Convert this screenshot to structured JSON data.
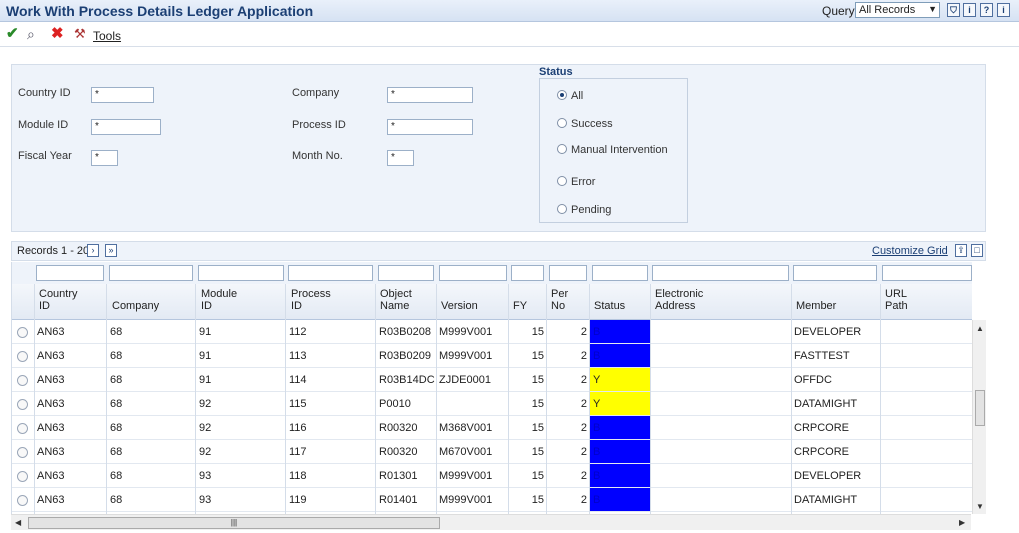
{
  "window": {
    "title": "Work With Process Details Ledger Application",
    "query_label": "Query:",
    "query_value": "All Records"
  },
  "toolbar": {
    "tools_label": "Tools"
  },
  "filter": {
    "country_id_label": "Country ID",
    "country_id_value": "*",
    "module_id_label": "Module ID",
    "module_id_value": "*",
    "fiscal_year_label": "Fiscal Year",
    "fiscal_year_value": "*",
    "company_label": "Company",
    "company_value": "*",
    "process_id_label": "Process ID",
    "process_id_value": "*",
    "month_no_label": "Month No.",
    "month_no_value": "*",
    "status_title": "Status",
    "status_options": [
      "All",
      "Success",
      "Manual Intervention",
      "Error",
      "Pending"
    ],
    "status_selected": "All"
  },
  "grid": {
    "records_label": "Records 1 - 20",
    "customize_label": "Customize Grid",
    "columns": [
      [
        "Country",
        "ID"
      ],
      [
        "",
        "Company"
      ],
      [
        "Module",
        "ID"
      ],
      [
        "Process",
        "ID"
      ],
      [
        "Object",
        "Name"
      ],
      [
        "",
        "Version"
      ],
      [
        "",
        "FY"
      ],
      [
        "Per",
        "No"
      ],
      [
        "",
        "Status"
      ],
      [
        "Electronic",
        "Address"
      ],
      [
        "",
        "Member"
      ],
      [
        "URL",
        "Path"
      ]
    ],
    "rows": [
      {
        "country": "AN63",
        "company": "68",
        "module": "91",
        "process": "112",
        "object": "R03B0208",
        "version": "M999V001",
        "fy": "15",
        "per": "2",
        "status": "B",
        "member": "DEVELOPER"
      },
      {
        "country": "AN63",
        "company": "68",
        "module": "91",
        "process": "113",
        "object": "R03B0209",
        "version": "M999V001",
        "fy": "15",
        "per": "2",
        "status": "B",
        "member": "FASTTEST"
      },
      {
        "country": "AN63",
        "company": "68",
        "module": "91",
        "process": "114",
        "object": "R03B14DC",
        "version": "ZJDE0001",
        "fy": "15",
        "per": "2",
        "status": "Y",
        "member": "OFFDC"
      },
      {
        "country": "AN63",
        "company": "68",
        "module": "92",
        "process": "115",
        "object": "P0010",
        "version": "",
        "fy": "15",
        "per": "2",
        "status": "Y",
        "member": "DATAMIGHT"
      },
      {
        "country": "AN63",
        "company": "68",
        "module": "92",
        "process": "116",
        "object": "R00320",
        "version": "M368V001",
        "fy": "15",
        "per": "2",
        "status": "B",
        "member": "CRPCORE"
      },
      {
        "country": "AN63",
        "company": "68",
        "module": "92",
        "process": "117",
        "object": "R00320",
        "version": "M670V001",
        "fy": "15",
        "per": "2",
        "status": "B",
        "member": "CRPCORE"
      },
      {
        "country": "AN63",
        "company": "68",
        "module": "93",
        "process": "118",
        "object": "R01301",
        "version": "M999V001",
        "fy": "15",
        "per": "2",
        "status": "B",
        "member": "DEVELOPER"
      },
      {
        "country": "AN63",
        "company": "68",
        "module": "93",
        "process": "119",
        "object": "R01401",
        "version": "M999V001",
        "fy": "15",
        "per": "2",
        "status": "B",
        "member": "DATAMIGHT"
      }
    ]
  },
  "colors": {
    "status_B": "#0000ff",
    "status_Y": "#ffff00",
    "title_blue": "#1b3f74"
  },
  "icons": [
    "checkmark-icon",
    "search-icon",
    "close-icon",
    "tools-icon",
    "filter-icon",
    "help-icon",
    "next-page-icon",
    "last-page-icon",
    "export-icon",
    "maximize-icon"
  ]
}
